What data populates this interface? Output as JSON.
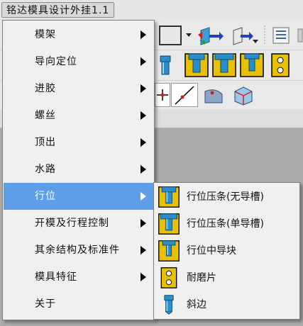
{
  "menubar": {
    "title": "铭达模具设计外挂1.1"
  },
  "menu": {
    "items": [
      {
        "label": "模架",
        "has_submenu": true
      },
      {
        "label": "导向定位",
        "has_submenu": true
      },
      {
        "label": "进胶",
        "has_submenu": true
      },
      {
        "label": "螺丝",
        "has_submenu": true
      },
      {
        "label": "顶出",
        "has_submenu": true
      },
      {
        "label": "水路",
        "has_submenu": true
      },
      {
        "label": "行位",
        "has_submenu": true,
        "active": true
      },
      {
        "label": "开模及行程控制",
        "has_submenu": true
      },
      {
        "label": "其余结构及标准件",
        "has_submenu": true
      },
      {
        "label": "模具特征",
        "has_submenu": true
      },
      {
        "label": "关于",
        "has_submenu": false
      }
    ]
  },
  "submenu": {
    "items": [
      {
        "label": "行位压条(无导槽)",
        "icon": "gib-no-groove-icon"
      },
      {
        "label": "行位压条(单导槽)",
        "icon": "gib-single-groove-icon"
      },
      {
        "label": "行位中导块",
        "icon": "center-guide-block-icon"
      },
      {
        "label": "耐磨片",
        "icon": "wear-plate-icon"
      },
      {
        "label": "斜边",
        "icon": "angled-edge-icon"
      }
    ]
  },
  "colors": {
    "menu_highlight": "#5c9ee8",
    "menu_background": "#f0f0f0",
    "icon_gold": "#e8c000",
    "icon_steel": "#2a8fc9"
  }
}
